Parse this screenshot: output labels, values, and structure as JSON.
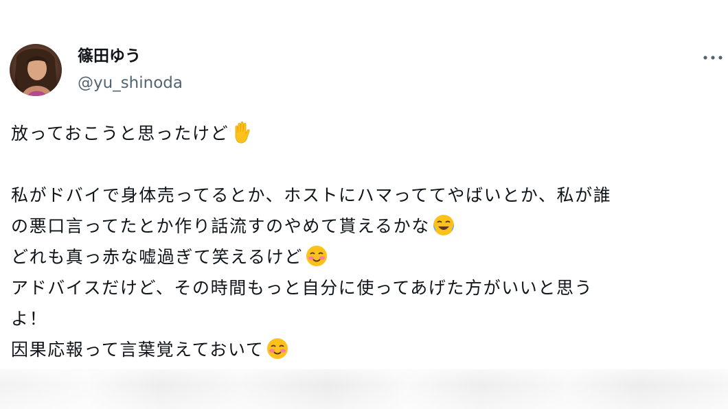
{
  "author": {
    "display_name": "篠田ゆう",
    "handle": "@yu_shinoda"
  },
  "more_menu": {
    "icon": "more-horizontal-icon",
    "glyph": "···"
  },
  "tweet": {
    "lines": [
      {
        "text": "放っておこうと思ったけど",
        "emoji": "raised-hand-icon"
      },
      {
        "text": ""
      },
      {
        "text": "私がドバイで身体売ってるとか、ホストにハマっててやばいとか、私が誰"
      },
      {
        "text": "の悪口言ってたとか作り話流すのやめて貰えるかな",
        "emoji": "tears-of-joy-icon"
      },
      {
        "text": "どれも真っ赤な嘘過ぎて笑えるけど",
        "emoji": "smiling-blush-icon"
      },
      {
        "text": "アドバイスだけど、その時間もっと自分に使ってあげた方がいいと思う"
      },
      {
        "text": "よ！"
      },
      {
        "text": "因果応報って言葉覚えておいて",
        "emoji": "smiling-blush-icon"
      }
    ]
  },
  "colors": {
    "text": "#0f1419",
    "secondary_text": "#536471",
    "background": "#ffffff"
  }
}
